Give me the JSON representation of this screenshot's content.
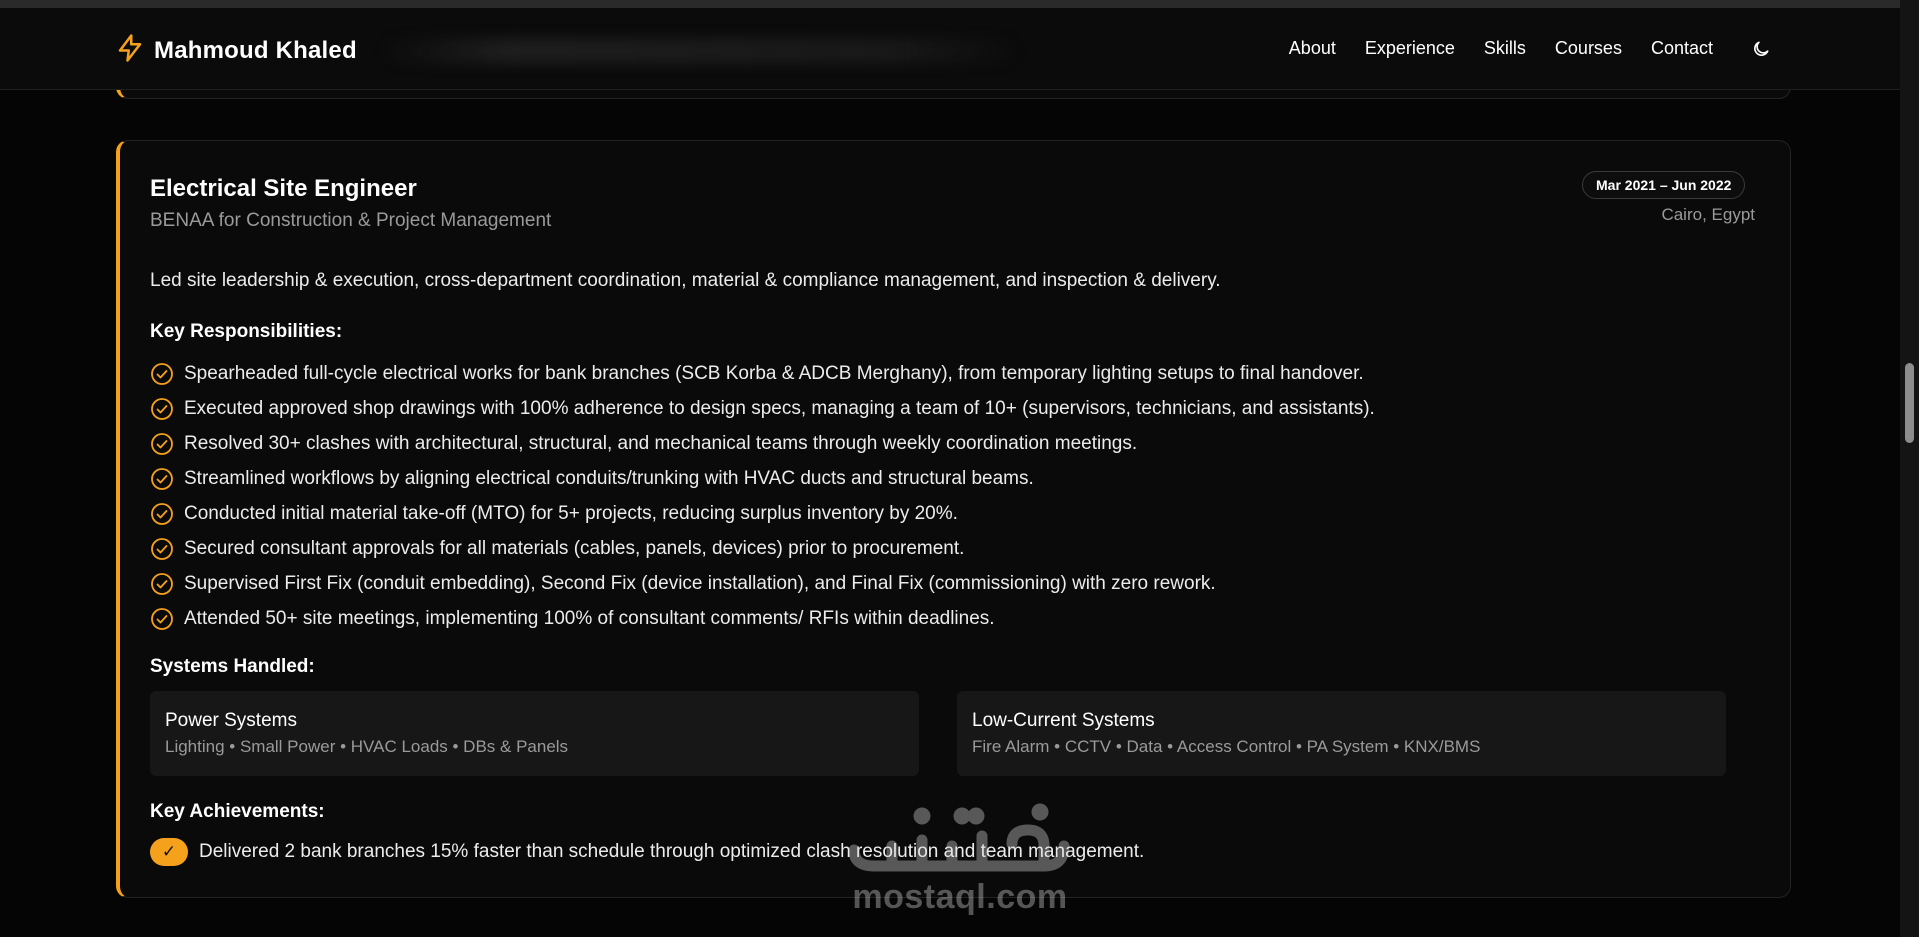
{
  "header": {
    "brand_name": "Mahmoud Khaled",
    "nav": [
      "About",
      "Experience",
      "Skills",
      "Courses",
      "Contact"
    ]
  },
  "job": {
    "title": "Electrical Site Engineer",
    "company": "BENAA for Construction & Project Management",
    "dates": "Mar 2021 – Jun 2022",
    "location": "Cairo, Egypt",
    "summary": "Led site leadership & execution, cross-department coordination, material & compliance management, and inspection & delivery.",
    "responsibilities_heading": "Key Responsibilities:",
    "responsibilities": [
      "Spearheaded full-cycle electrical works for bank branches (SCB Korba & ADCB Merghany), from temporary lighting setups to final handover.",
      "Executed approved shop drawings with 100% adherence to design specs, managing a team of 10+ (supervisors, technicians, and assistants).",
      "Resolved 30+ clashes with architectural, structural, and mechanical teams through weekly coordination meetings.",
      "Streamlined workflows by aligning electrical conduits/trunking with HVAC ducts and structural beams.",
      "Conducted initial material take-off (MTO) for 5+ projects, reducing surplus inventory by 20%.",
      "Secured consultant approvals for all materials (cables, panels, devices) prior to procurement.",
      "Supervised First Fix (conduit embedding), Second Fix (device installation), and Final Fix (commissioning) with zero rework.",
      "Attended 50+ site meetings, implementing 100% of consultant comments/ RFIs within deadlines."
    ],
    "systems_heading": "Systems Handled:",
    "systems": [
      {
        "name": "Power Systems",
        "items": "Lighting • Small Power • HVAC Loads • DBs & Panels"
      },
      {
        "name": "Low-Current Systems",
        "items": "Fire Alarm • CCTV • Data • Access Control • PA System • KNX/BMS"
      }
    ],
    "achievements_heading": "Key Achievements:",
    "achievement_check": "✓",
    "achievement": "Delivered 2 bank branches 15% faster than schedule through optimized clash resolution and team management."
  },
  "watermark": {
    "latin": "mostaql.com",
    "arabic": "مستقل"
  },
  "colors": {
    "accent": "#f5a11c",
    "background": "#050505",
    "card": "#0a0a0a",
    "panel": "#171717",
    "muted_text": "#9a9a9a"
  },
  "icons": {
    "brand": "lightning-bolt-icon",
    "theme": "moon-icon",
    "list": "check-circle-icon"
  }
}
